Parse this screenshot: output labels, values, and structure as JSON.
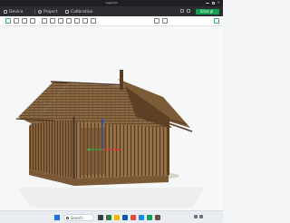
{
  "window": {
    "title": "zegerhid"
  },
  "tabs": [
    {
      "label": "Device",
      "icon": "device-icon"
    },
    {
      "label": "Project",
      "icon": "project-icon"
    },
    {
      "label": "Calibration",
      "icon": "calibration-icon"
    }
  ],
  "actions": {
    "slice_label": "Slice pl"
  },
  "taskbar": {
    "search_placeholder": "Search"
  },
  "colors": {
    "titlebar": "#1d1f22",
    "tabbar": "#2b2d30",
    "accent": "#12a150",
    "viewport": "#f6f7f8",
    "wood_dark": "#6b4a2b",
    "wood_light": "#a07a4f",
    "axis_x": "#e53935",
    "axis_y": "#43a047",
    "axis_z": "#3949ab"
  }
}
